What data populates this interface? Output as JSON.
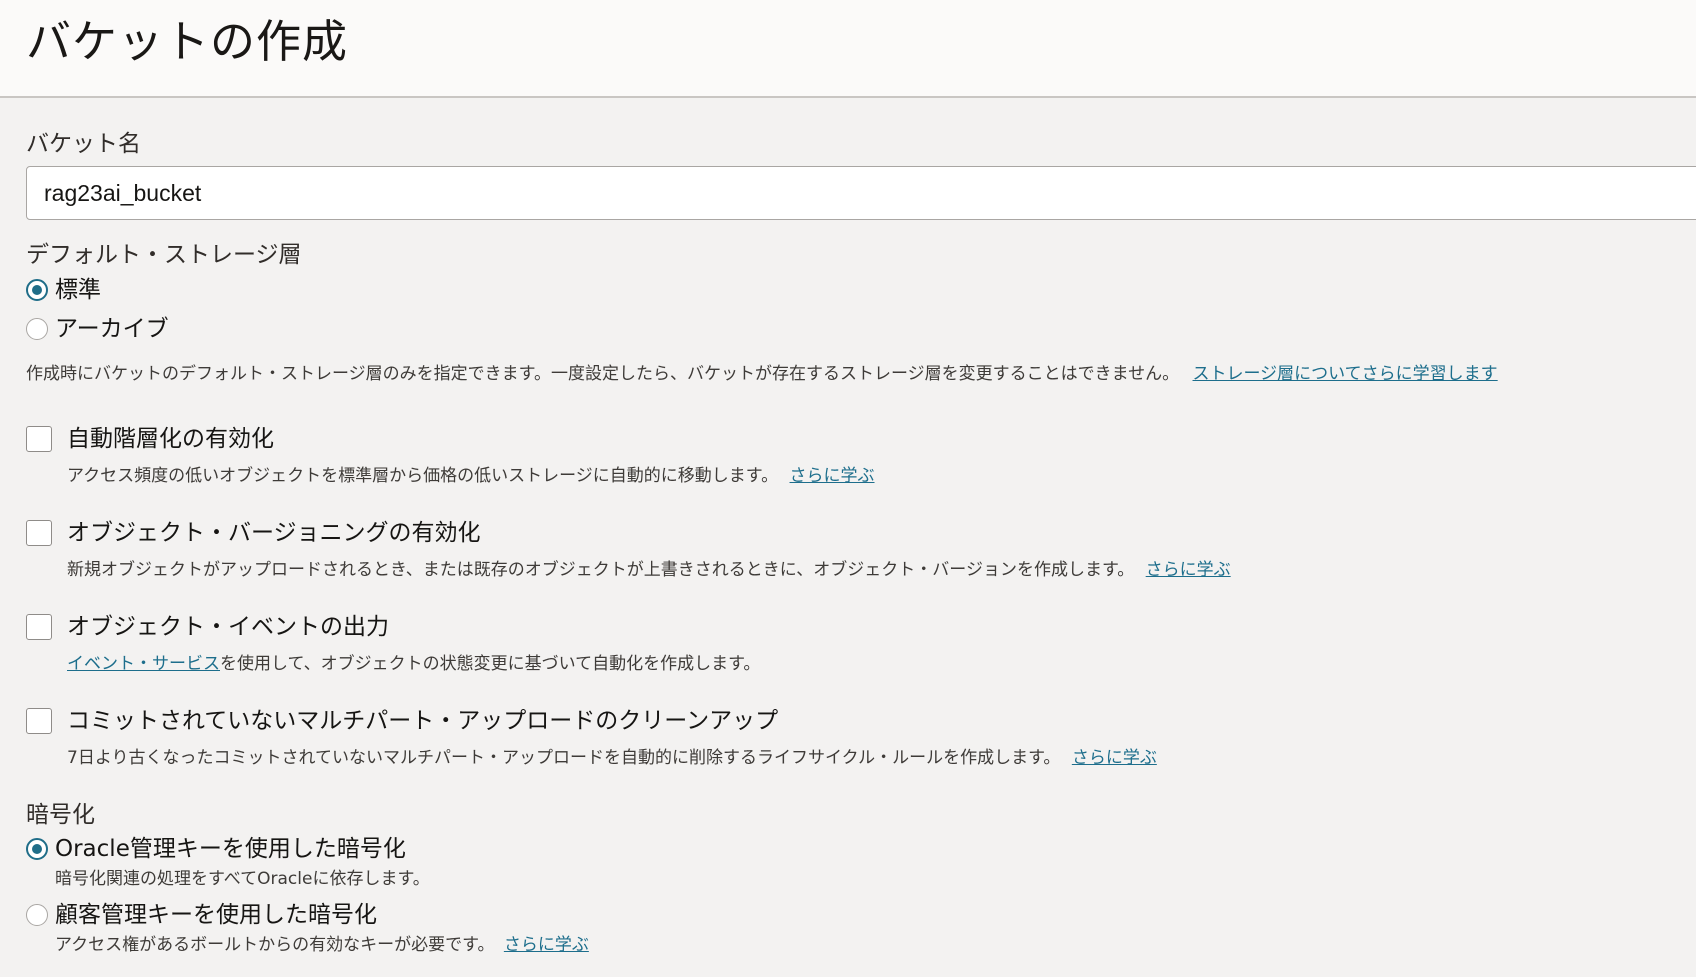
{
  "header": {
    "title": "バケットの作成"
  },
  "bucket_name": {
    "label": "バケット名",
    "value": "rag23ai_bucket"
  },
  "storage_tier": {
    "label": "デフォルト・ストレージ層",
    "options": [
      {
        "label": "標準",
        "selected": true
      },
      {
        "label": "アーカイブ",
        "selected": false
      }
    ],
    "help_text": "作成時にバケットのデフォルト・ストレージ層のみを指定できます。一度設定したら、バケットが存在するストレージ層を変更することはできません。",
    "help_link": "ストレージ層についてさらに学習します"
  },
  "options": {
    "auto_tiering": {
      "label": "自動階層化の有効化",
      "checked": false,
      "help_text": "アクセス頻度の低いオブジェクトを標準層から価格の低いストレージに自動的に移動します。",
      "help_link": "さらに学ぶ"
    },
    "versioning": {
      "label": "オブジェクト・バージョニングの有効化",
      "checked": false,
      "help_text": "新規オブジェクトがアップロードされるとき、または既存のオブジェクトが上書きされるときに、オブジェクト・バージョンを作成します。",
      "help_link": "さらに学ぶ"
    },
    "events": {
      "label": "オブジェクト・イベントの出力",
      "checked": false,
      "help_link": "イベント・サービス",
      "help_text": "を使用して、オブジェクトの状態変更に基づいて自動化を作成します。"
    },
    "multipart_cleanup": {
      "label": "コミットされていないマルチパート・アップロードのクリーンアップ",
      "checked": false,
      "help_text": "7日より古くなったコミットされていないマルチパート・アップロードを自動的に削除するライフサイクル・ルールを作成します。",
      "help_link": "さらに学ぶ"
    }
  },
  "encryption": {
    "label": "暗号化",
    "options": [
      {
        "label": "Oracle管理キーを使用した暗号化",
        "selected": true,
        "help_text": "暗号化関連の処理をすべてOracleに依存します。"
      },
      {
        "label": "顧客管理キーを使用した暗号化",
        "selected": false,
        "help_text": "アクセス権があるボールトからの有効なキーが必要です。",
        "help_link": "さらに学ぶ"
      }
    ]
  },
  "colors": {
    "accent": "#1f6d88",
    "link": "#1d6e8c",
    "background": "#f3f2f1",
    "header_bg": "#fbfaf9"
  }
}
